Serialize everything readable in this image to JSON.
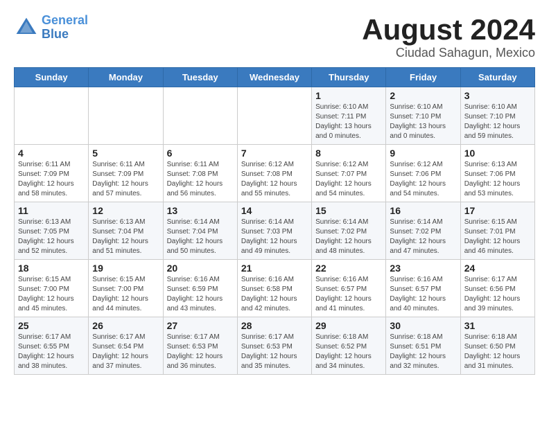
{
  "header": {
    "logo_line1": "General",
    "logo_line2": "Blue",
    "month": "August 2024",
    "location": "Ciudad Sahagun, Mexico"
  },
  "days_of_week": [
    "Sunday",
    "Monday",
    "Tuesday",
    "Wednesday",
    "Thursday",
    "Friday",
    "Saturday"
  ],
  "weeks": [
    [
      {
        "day": "",
        "info": ""
      },
      {
        "day": "",
        "info": ""
      },
      {
        "day": "",
        "info": ""
      },
      {
        "day": "",
        "info": ""
      },
      {
        "day": "1",
        "info": "Sunrise: 6:10 AM\nSunset: 7:11 PM\nDaylight: 13 hours and 0 minutes."
      },
      {
        "day": "2",
        "info": "Sunrise: 6:10 AM\nSunset: 7:10 PM\nDaylight: 13 hours and 0 minutes."
      },
      {
        "day": "3",
        "info": "Sunrise: 6:10 AM\nSunset: 7:10 PM\nDaylight: 12 hours and 59 minutes."
      }
    ],
    [
      {
        "day": "4",
        "info": "Sunrise: 6:11 AM\nSunset: 7:09 PM\nDaylight: 12 hours and 58 minutes."
      },
      {
        "day": "5",
        "info": "Sunrise: 6:11 AM\nSunset: 7:09 PM\nDaylight: 12 hours and 57 minutes."
      },
      {
        "day": "6",
        "info": "Sunrise: 6:11 AM\nSunset: 7:08 PM\nDaylight: 12 hours and 56 minutes."
      },
      {
        "day": "7",
        "info": "Sunrise: 6:12 AM\nSunset: 7:08 PM\nDaylight: 12 hours and 55 minutes."
      },
      {
        "day": "8",
        "info": "Sunrise: 6:12 AM\nSunset: 7:07 PM\nDaylight: 12 hours and 54 minutes."
      },
      {
        "day": "9",
        "info": "Sunrise: 6:12 AM\nSunset: 7:06 PM\nDaylight: 12 hours and 54 minutes."
      },
      {
        "day": "10",
        "info": "Sunrise: 6:13 AM\nSunset: 7:06 PM\nDaylight: 12 hours and 53 minutes."
      }
    ],
    [
      {
        "day": "11",
        "info": "Sunrise: 6:13 AM\nSunset: 7:05 PM\nDaylight: 12 hours and 52 minutes."
      },
      {
        "day": "12",
        "info": "Sunrise: 6:13 AM\nSunset: 7:04 PM\nDaylight: 12 hours and 51 minutes."
      },
      {
        "day": "13",
        "info": "Sunrise: 6:14 AM\nSunset: 7:04 PM\nDaylight: 12 hours and 50 minutes."
      },
      {
        "day": "14",
        "info": "Sunrise: 6:14 AM\nSunset: 7:03 PM\nDaylight: 12 hours and 49 minutes."
      },
      {
        "day": "15",
        "info": "Sunrise: 6:14 AM\nSunset: 7:02 PM\nDaylight: 12 hours and 48 minutes."
      },
      {
        "day": "16",
        "info": "Sunrise: 6:14 AM\nSunset: 7:02 PM\nDaylight: 12 hours and 47 minutes."
      },
      {
        "day": "17",
        "info": "Sunrise: 6:15 AM\nSunset: 7:01 PM\nDaylight: 12 hours and 46 minutes."
      }
    ],
    [
      {
        "day": "18",
        "info": "Sunrise: 6:15 AM\nSunset: 7:00 PM\nDaylight: 12 hours and 45 minutes."
      },
      {
        "day": "19",
        "info": "Sunrise: 6:15 AM\nSunset: 7:00 PM\nDaylight: 12 hours and 44 minutes."
      },
      {
        "day": "20",
        "info": "Sunrise: 6:16 AM\nSunset: 6:59 PM\nDaylight: 12 hours and 43 minutes."
      },
      {
        "day": "21",
        "info": "Sunrise: 6:16 AM\nSunset: 6:58 PM\nDaylight: 12 hours and 42 minutes."
      },
      {
        "day": "22",
        "info": "Sunrise: 6:16 AM\nSunset: 6:57 PM\nDaylight: 12 hours and 41 minutes."
      },
      {
        "day": "23",
        "info": "Sunrise: 6:16 AM\nSunset: 6:57 PM\nDaylight: 12 hours and 40 minutes."
      },
      {
        "day": "24",
        "info": "Sunrise: 6:17 AM\nSunset: 6:56 PM\nDaylight: 12 hours and 39 minutes."
      }
    ],
    [
      {
        "day": "25",
        "info": "Sunrise: 6:17 AM\nSunset: 6:55 PM\nDaylight: 12 hours and 38 minutes."
      },
      {
        "day": "26",
        "info": "Sunrise: 6:17 AM\nSunset: 6:54 PM\nDaylight: 12 hours and 37 minutes."
      },
      {
        "day": "27",
        "info": "Sunrise: 6:17 AM\nSunset: 6:53 PM\nDaylight: 12 hours and 36 minutes."
      },
      {
        "day": "28",
        "info": "Sunrise: 6:17 AM\nSunset: 6:53 PM\nDaylight: 12 hours and 35 minutes."
      },
      {
        "day": "29",
        "info": "Sunrise: 6:18 AM\nSunset: 6:52 PM\nDaylight: 12 hours and 34 minutes."
      },
      {
        "day": "30",
        "info": "Sunrise: 6:18 AM\nSunset: 6:51 PM\nDaylight: 12 hours and 32 minutes."
      },
      {
        "day": "31",
        "info": "Sunrise: 6:18 AM\nSunset: 6:50 PM\nDaylight: 12 hours and 31 minutes."
      }
    ]
  ]
}
